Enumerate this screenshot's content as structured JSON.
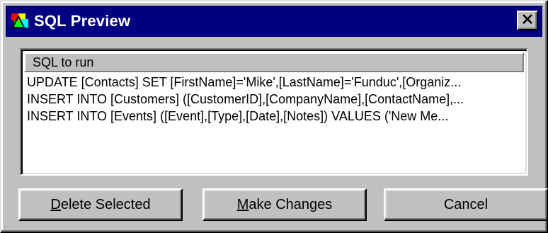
{
  "window": {
    "title": "SQL Preview",
    "app_icon": "colorful-app-icon",
    "close_icon": "close-x-icon"
  },
  "list": {
    "column_header": "SQL to run",
    "rows": [
      "UPDATE [Contacts] SET [FirstName]='Mike',[LastName]='Funduc',[Organiz...",
      "INSERT INTO [Customers] ([CustomerID],[CompanyName],[ContactName],...",
      "INSERT INTO [Events] ([Event],[Type],[Date],[Notes]) VALUES ('New Me..."
    ]
  },
  "buttons": {
    "delete_selected": {
      "mnemonic": "D",
      "rest": "elete Selected"
    },
    "make_changes": {
      "mnemonic": "M",
      "rest": "ake Changes"
    },
    "cancel": {
      "label": "Cancel"
    }
  },
  "colors": {
    "titlebar_bg": "#000080",
    "face": "#c0c0c0",
    "list_bg": "#ffffff"
  }
}
